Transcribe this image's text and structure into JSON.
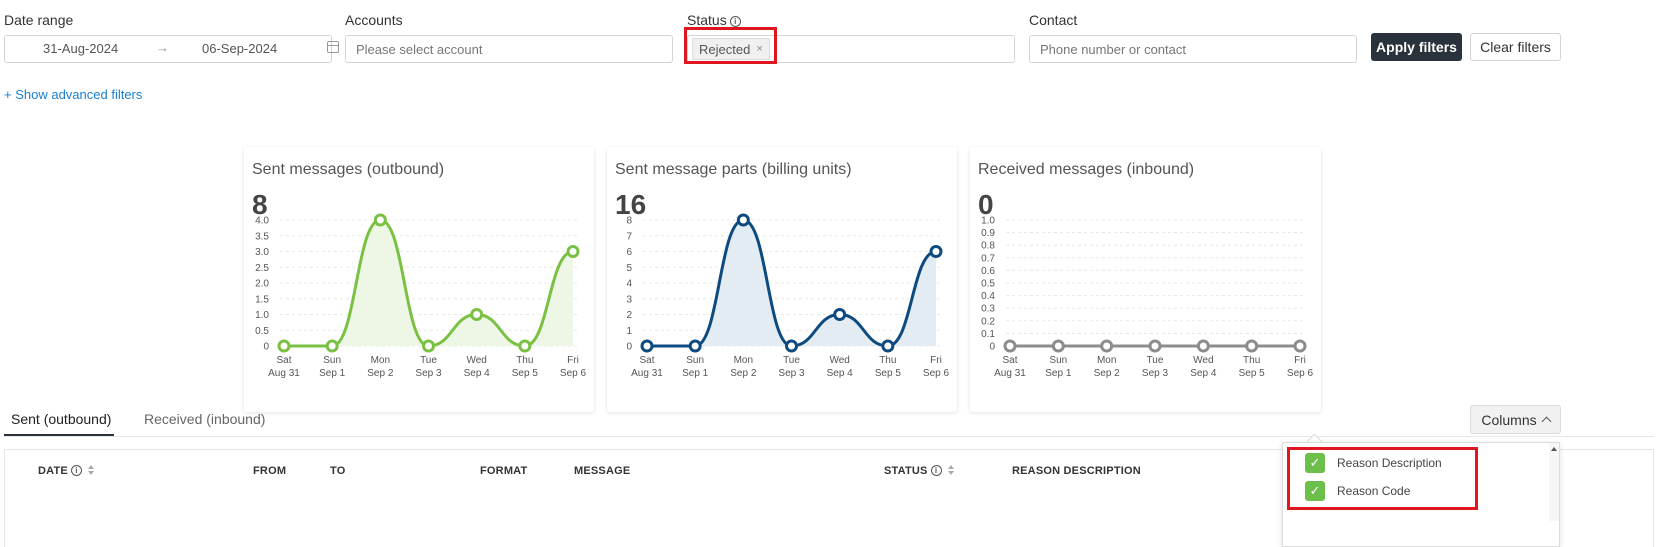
{
  "filters": {
    "date_range_label": "Date range",
    "date_from": "31-Aug-2024",
    "date_arrow": "→",
    "date_to": "06-Sep-2024",
    "accounts_label": "Accounts",
    "accounts_placeholder": "Please select account",
    "status_label": "Status",
    "status_tag": "Rejected",
    "status_tag_remove": "×",
    "contact_label": "Contact",
    "contact_placeholder": "Phone number or contact",
    "apply_label": "Apply filters",
    "clear_label": "Clear filters",
    "advanced_link": "+ Show advanced filters"
  },
  "cards": [
    {
      "title": "Sent messages (outbound)",
      "value": "8"
    },
    {
      "title": "Sent message parts (billing units)",
      "value": "16"
    },
    {
      "title": "Received messages (inbound)",
      "value": "0"
    }
  ],
  "chart_data": [
    {
      "type": "area",
      "title": "Sent messages (outbound)",
      "categories": [
        "Sat Aug 31",
        "Sun Sep 1",
        "Mon Sep 2",
        "Tue Sep 3",
        "Wed Sep 4",
        "Thu Sep 5",
        "Fri Sep 6"
      ],
      "category_days": [
        "Sat",
        "Sun",
        "Mon",
        "Tue",
        "Wed",
        "Thu",
        "Fri"
      ],
      "category_dates": [
        "Aug 31",
        "Sep 1",
        "Sep 2",
        "Sep 3",
        "Sep 4",
        "Sep 5",
        "Sep 6"
      ],
      "values": [
        0,
        0,
        4,
        0,
        1,
        0,
        3
      ],
      "yticks": [
        "0",
        "0.5",
        "1.0",
        "1.5",
        "2.0",
        "2.5",
        "3.0",
        "3.5",
        "4.0"
      ],
      "ylim": [
        0,
        4
      ],
      "color": "#7ac143",
      "fill": "#eef7e6"
    },
    {
      "type": "area",
      "title": "Sent message parts (billing units)",
      "categories": [
        "Sat Aug 31",
        "Sun Sep 1",
        "Mon Sep 2",
        "Tue Sep 3",
        "Wed Sep 4",
        "Thu Sep 5",
        "Fri Sep 6"
      ],
      "category_days": [
        "Sat",
        "Sun",
        "Mon",
        "Tue",
        "Wed",
        "Thu",
        "Fri"
      ],
      "category_dates": [
        "Aug 31",
        "Sep 1",
        "Sep 2",
        "Sep 3",
        "Sep 4",
        "Sep 5",
        "Sep 6"
      ],
      "values": [
        0,
        0,
        8,
        0,
        2,
        0,
        6
      ],
      "yticks": [
        "0",
        "1",
        "2",
        "3",
        "4",
        "5",
        "6",
        "7",
        "8"
      ],
      "ylim": [
        0,
        8
      ],
      "color": "#0d4a7f",
      "fill": "#e3ebf3"
    },
    {
      "type": "line",
      "title": "Received messages (inbound)",
      "categories": [
        "Sat Aug 31",
        "Sun Sep 1",
        "Mon Sep 2",
        "Tue Sep 3",
        "Wed Sep 4",
        "Thu Sep 5",
        "Fri Sep 6"
      ],
      "category_days": [
        "Sat",
        "Sun",
        "Mon",
        "Tue",
        "Wed",
        "Thu",
        "Fri"
      ],
      "category_dates": [
        "Aug 31",
        "Sep 1",
        "Sep 2",
        "Sep 3",
        "Sep 4",
        "Sep 5",
        "Sep 6"
      ],
      "values": [
        0,
        0,
        0,
        0,
        0,
        0,
        0
      ],
      "yticks": [
        "0",
        "0.1",
        "0.2",
        "0.3",
        "0.4",
        "0.5",
        "0.6",
        "0.7",
        "0.8",
        "0.9",
        "1.0"
      ],
      "ylim": [
        0,
        1
      ],
      "color": "#8c8c8c",
      "fill": "none"
    }
  ],
  "tabs": {
    "sent": "Sent (outbound)",
    "received": "Received (inbound)"
  },
  "columns_button": "Columns",
  "table_headers": {
    "date": "DATE",
    "from": "FROM",
    "to": "TO",
    "format": "FORMAT",
    "message": "MESSAGE",
    "status": "STATUS",
    "reason_description": "REASON DESCRIPTION"
  },
  "columns_dropdown": [
    {
      "label": "Reason Description",
      "checked": true
    },
    {
      "label": "Reason Code",
      "checked": true
    }
  ],
  "highlight_color": "#e0161e"
}
